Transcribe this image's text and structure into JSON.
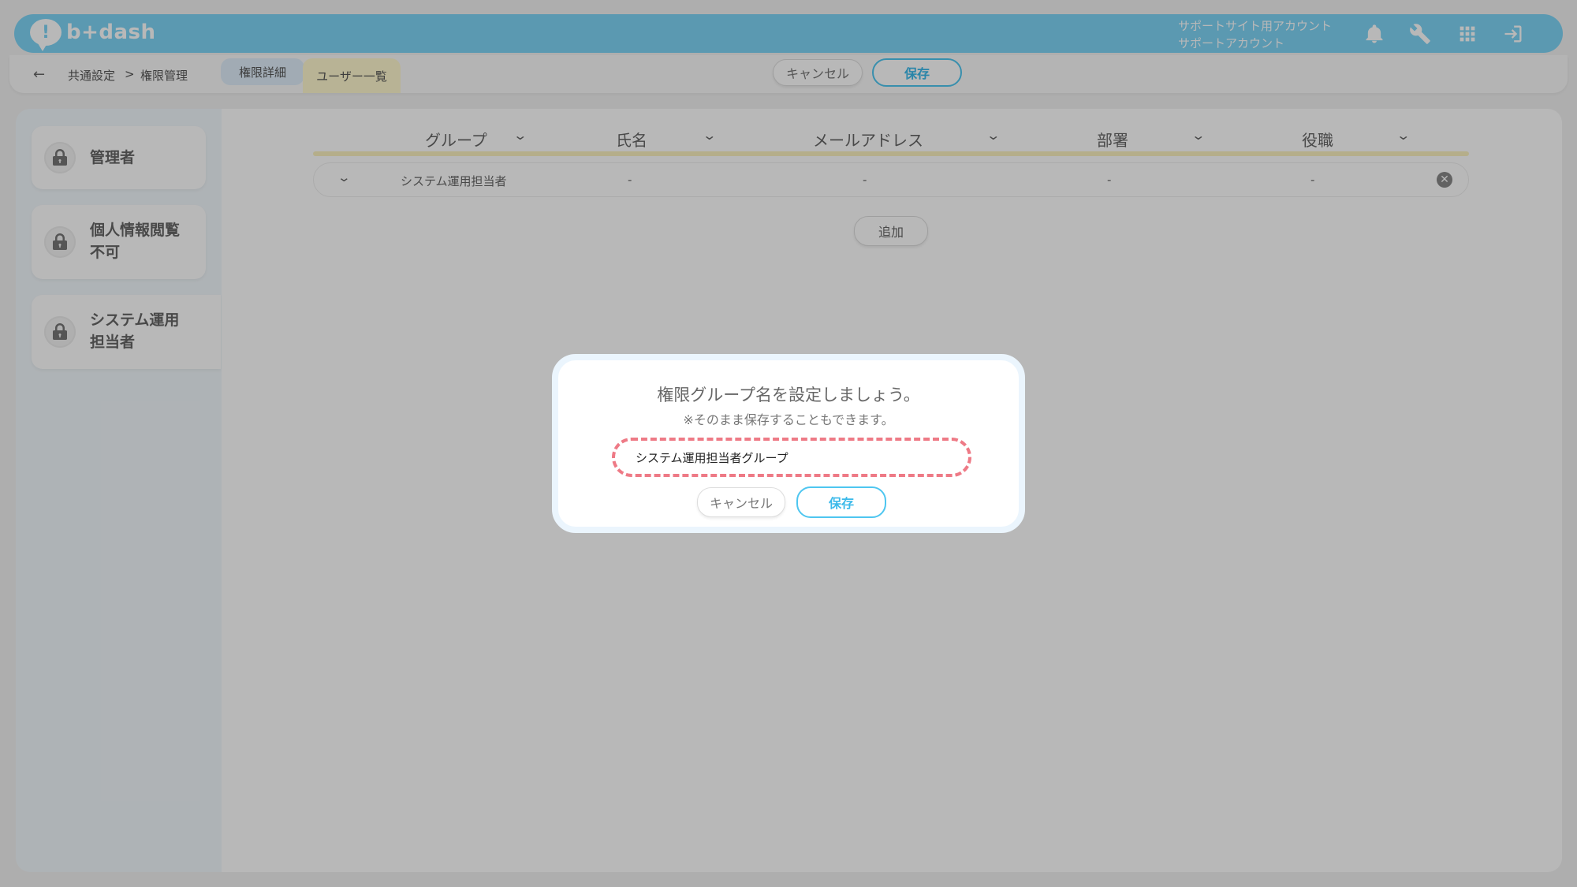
{
  "header": {
    "logo_text": "b+dash",
    "account_line1": "サポートサイト用アカウント",
    "account_line2": "サポートアカウント",
    "icons": [
      "bell-icon",
      "wrench-icon",
      "grid-icon",
      "logout-icon"
    ]
  },
  "subbar": {
    "back_icon": "←",
    "breadcrumb_1": "共通設定",
    "breadcrumb_sep": ">",
    "breadcrumb_2": "権限管理",
    "tab_detail": "権限詳細",
    "tab_users": "ユーザー一覧",
    "cancel_label": "キャンセル",
    "save_label": "保存"
  },
  "sidebar": {
    "items": [
      {
        "line1": "管理者",
        "line2": ""
      },
      {
        "line1": "個人情報閲覧",
        "line2": "不可"
      },
      {
        "line1": "システム運用",
        "line2": "担当者"
      }
    ]
  },
  "table": {
    "headers": [
      "グループ",
      "氏名",
      "メールアドレス",
      "部署",
      "役職"
    ],
    "rows": [
      {
        "group": "システム運用担当者",
        "name": "-",
        "email": "-",
        "dept": "-",
        "title": "-"
      }
    ],
    "add_label": "追加"
  },
  "modal": {
    "title": "権限グループ名を設定しましょう。",
    "subtitle": "※そのまま保存することもできます。",
    "input_value": "システム運用担当者グループ",
    "cancel_label": "キャンセル",
    "save_label": "保存"
  },
  "colors": {
    "header": "#7ed4f5",
    "accent": "#4ec6f0",
    "highlight_dash": "#ee7a86",
    "table_underline": "#fbf1c0"
  }
}
